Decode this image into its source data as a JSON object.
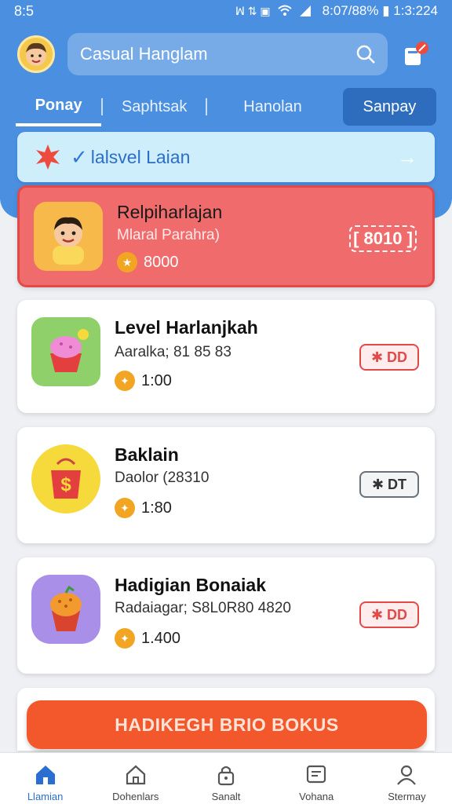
{
  "status_bar": {
    "time": "8:5",
    "indicators": "ꟽ ⇅ ▣",
    "battery": "8:07/88% ▮ 1:3:224"
  },
  "header": {
    "title": "Casual Hanglam",
    "tabs": [
      "Ponay",
      "Saphtsak",
      "Hanolan",
      "Sanpay"
    ]
  },
  "banner": {
    "check": "✓",
    "label": "lalsvel Laian",
    "arrow": "→"
  },
  "cards": [
    {
      "title": "Relpiharlajan",
      "subtitle": "Mlaral Parahra)",
      "reward": "8000",
      "badge": "[ 8010 ]",
      "badge_color": "#ffffff"
    },
    {
      "title": "Level Harlanjkah",
      "subtitle": "Aaralka; 81 85 83",
      "reward": "1:00",
      "badge": "✱ DD",
      "badge_color": "#e24a4a"
    },
    {
      "title": "Baklain",
      "subtitle": "Daolor (28310",
      "reward": "1:80",
      "badge": "✱ DT",
      "badge_color": "#333333"
    },
    {
      "title": "Hadigian Bonaiak",
      "subtitle": "Radaiagar; S8L0R80 4820",
      "reward": "1.400",
      "badge": "✱ DD",
      "badge_color": "#e24a4a"
    }
  ],
  "cta": {
    "label": "HADIKEGH BRIO BOKUS"
  },
  "bottom_nav": [
    {
      "label": "Llamian",
      "icon": "home-icon",
      "active": true
    },
    {
      "label": "Dohenlars",
      "icon": "home-outline-icon",
      "active": false
    },
    {
      "label": "Sanalt",
      "icon": "lock-icon",
      "active": false
    },
    {
      "label": "Vohana",
      "icon": "chat-icon",
      "active": false
    },
    {
      "label": "Stermay",
      "icon": "profile-icon",
      "active": false
    }
  ],
  "colors": {
    "header": "#4a8fe0",
    "highlight_card": "#f06c6c",
    "cta": "#f2582c",
    "active_nav": "#2a6fd0"
  }
}
